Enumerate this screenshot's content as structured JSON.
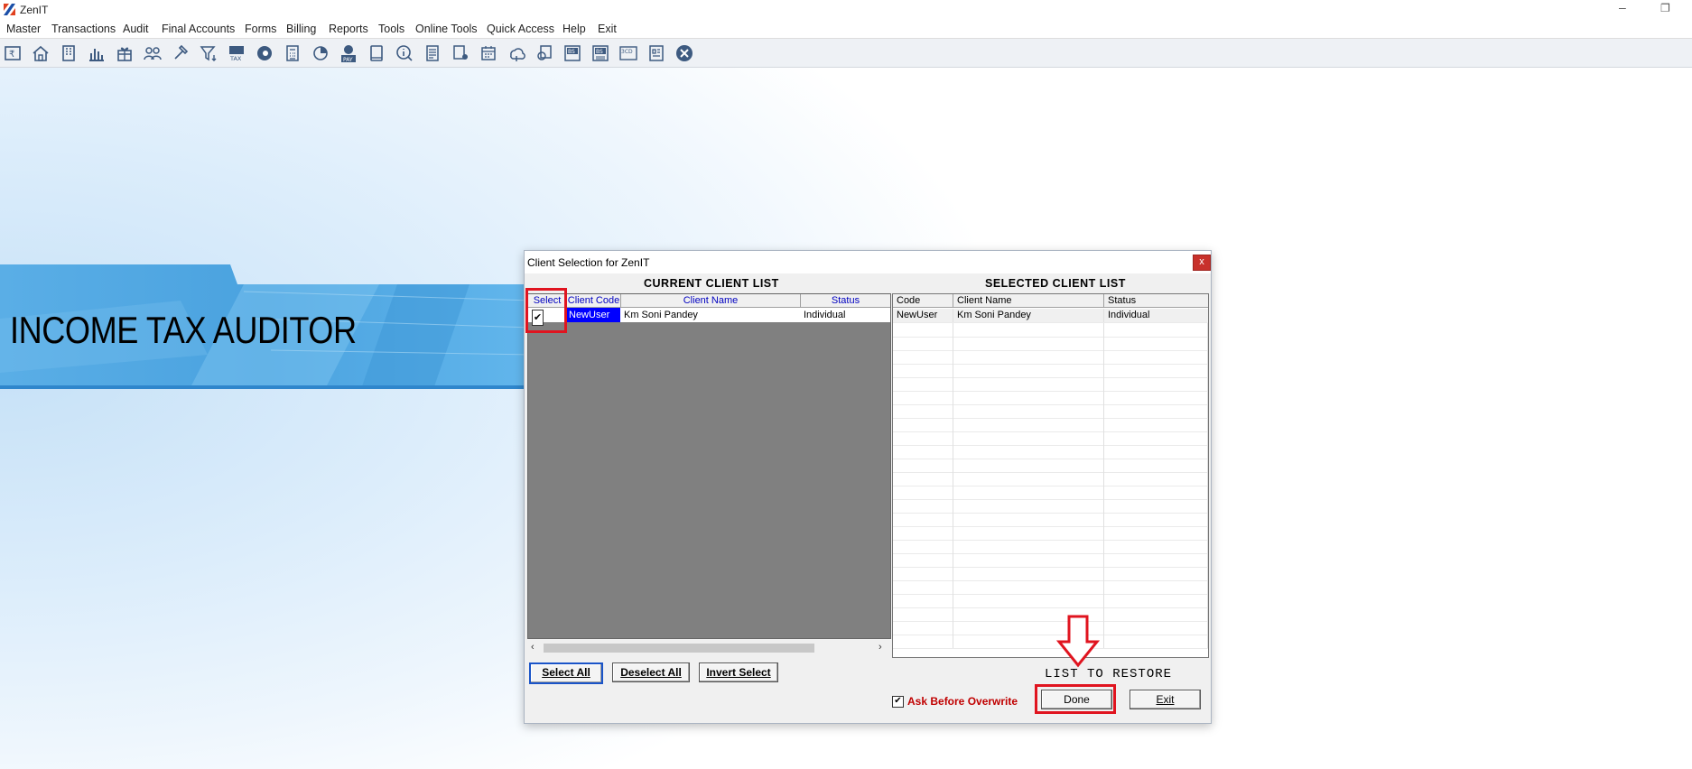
{
  "app": {
    "title": "ZenIT"
  },
  "menu": [
    "Master",
    "Transactions",
    "Audit",
    "Final Accounts",
    "Forms",
    "Billing",
    "Reports",
    "Tools",
    "Online Tools",
    "Quick Access",
    "Help",
    "Exit"
  ],
  "toolbar_icons": [
    "rupee-ledger-icon",
    "home-icon",
    "building-icon",
    "bar-chart-icon",
    "gift-icon",
    "users-icon",
    "hammer-icon",
    "filter-icon",
    "tax-icon",
    "eye-icon",
    "calculator-icon",
    "pie-chart-icon",
    "e-pay-icon",
    "book-icon",
    "info-icon",
    "sheet-icon",
    "document-user-icon",
    "calendar-icon",
    "shield-cloud-icon",
    "refresh-doc-icon",
    "bs-icon",
    "bs-alt-icon",
    "3cd-icon",
    "report-icon",
    "close-circle-icon"
  ],
  "toolbar_labels": {
    "tax": "TAX",
    "pay": "PAY",
    "bs": "BS",
    "bs2": "BS",
    "cd3": "3CD"
  },
  "banner": {
    "text": "INCOME TAX AUDITOR"
  },
  "dialog": {
    "title": "Client Selection for ZenIT",
    "close_label": "x",
    "current_heading": "CURRENT  CLIENT  LIST",
    "selected_heading": "SELECTED  CLIENT  LIST",
    "current_columns": [
      "Select",
      "Client Code",
      "Client Name",
      "Status"
    ],
    "current_rows": [
      {
        "selected": true,
        "code": "NewUser",
        "name": "Km Soni  Pandey",
        "status": "Individual"
      }
    ],
    "selected_columns": [
      "Code",
      "Client Name",
      "Status"
    ],
    "selected_rows": [
      {
        "code": "NewUser",
        "name": "Km Soni  Pandey",
        "status": "Individual"
      }
    ],
    "buttons": {
      "select_all": "Select All",
      "deselect_all": "Deselect All",
      "invert_select": "Invert Select",
      "done": "Done",
      "exit": "Exit"
    },
    "ask_before_overwrite": {
      "label": "Ask Before Overwrite",
      "checked": true
    },
    "restore_label": "LIST TO RESTORE",
    "check_mark": "✔"
  },
  "colors": {
    "highlight": "#e0141f",
    "selection": "#0000ff",
    "toolbar_icon": "#3d5a80"
  }
}
